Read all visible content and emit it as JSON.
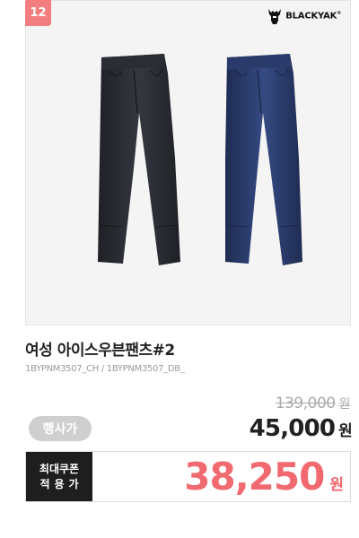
{
  "product": {
    "rank": "12",
    "brand": "BLACKYAK",
    "brand_mark": "®",
    "name": "여성 아이스우븐팬츠#2",
    "code": "1BYPNM3507_CH / 1BYPNM3507_DB_",
    "original_price": "139,000",
    "event_label": "행사가",
    "sale_price": "45,000",
    "currency": "원",
    "coupon_label_line1": "최대쿠폰",
    "coupon_label_line2": "적용가",
    "coupon_price": "38,250"
  },
  "colors": {
    "badge": "#f47d7f",
    "coupon_price": "#f06a70",
    "pants_left": "#2c2f36",
    "pants_right": "#2b3a66"
  },
  "icons": {
    "brand_logo": "yak-head-icon"
  }
}
